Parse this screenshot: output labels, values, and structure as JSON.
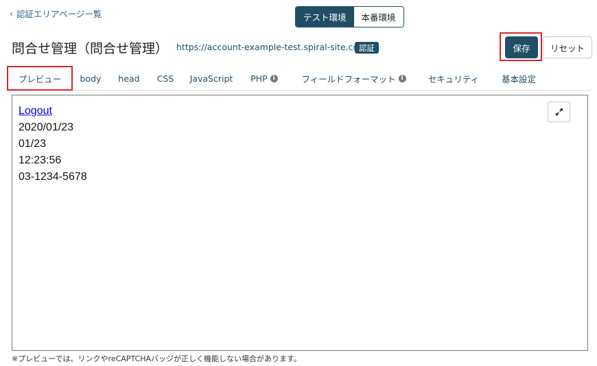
{
  "back_link": {
    "icon": "chevron-left-icon",
    "label": "認証エリアページ一覧"
  },
  "environment_toggle": {
    "options": [
      {
        "label": "テスト環境",
        "active": true
      },
      {
        "label": "本番環境",
        "active": false
      }
    ]
  },
  "header": {
    "title": "問合せ管理（問合せ管理）",
    "url": "https://account-example-test.spiral-site.com",
    "badge": "認証"
  },
  "actions": {
    "save_label": "保存",
    "reset_label": "リセット"
  },
  "tabs": [
    {
      "label": "プレビュー",
      "active": true
    },
    {
      "label": "body"
    },
    {
      "label": "head"
    },
    {
      "label": "CSS"
    },
    {
      "label": "JavaScript"
    },
    {
      "label": "PHP",
      "icon": "info-icon"
    },
    {
      "label": "フィールドフォーマット",
      "icon": "info-icon"
    },
    {
      "label": "セキュリティ"
    },
    {
      "label": "基本設定"
    }
  ],
  "preview": {
    "link": "Logout",
    "lines": [
      "2020/01/23",
      "01/23",
      "12:23:56",
      "03-1234-5678"
    ],
    "expand_icon": "expand-icon"
  },
  "footnote": "※プレビューでは、リンクやreCAPTCHAバッジが正しく機能しない場合があります。",
  "colors": {
    "primary": "#1f4e66",
    "highlight": "#d9252a",
    "link": "#0000ee"
  }
}
